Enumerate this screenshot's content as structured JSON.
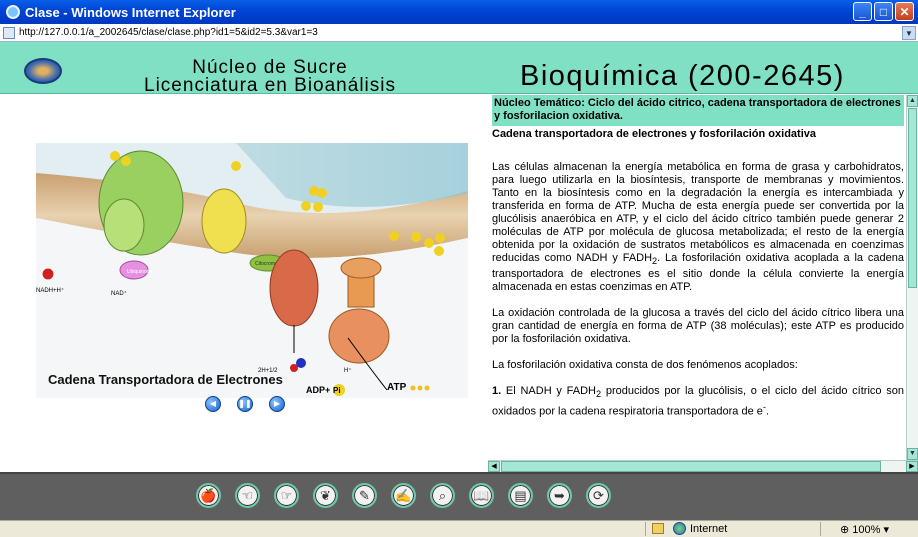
{
  "window": {
    "title": "Clase - Windows Internet Explorer",
    "url": "http://127.0.0.1/a_2002645/clase/clase.php?id1=5&id2=5.3&var1=3"
  },
  "header": {
    "line1": "Núcleo de Sucre",
    "line2": "Licenciatura en Bioanálisis",
    "course": "Bioquímica (200-2645)"
  },
  "figure": {
    "caption": "Cadena Transportadora de Electrones",
    "labels": {
      "nadh": "NADH+H⁺",
      "nad": "NAD⁺",
      "water": "2H+1/2",
      "adp": "ADP+",
      "pi": "Pi",
      "atp": "ATP",
      "hplus": "H⁺",
      "ubiquinona": "Ubiquinona",
      "citocromo": "Citocromo"
    },
    "controls": [
      "rewind",
      "pause",
      "play"
    ]
  },
  "content": {
    "tema": "Núcleo Temático: Ciclo del ácido citrico, cadena transportadora de electrones y fosforilacion oxidativa.",
    "subtitle": "Cadena transportadora de electrones y fosforilación oxidativa",
    "p1": "Las células almacenan la energía metabólica en forma de grasa y carbohidratos, para luego utilizarla en la biosíntesis, transporte de membranas y movimientos. Tanto en la biosíntesis como en la degradación la energía es intercambiada y transferida en forma de ATP. Mucha de esta energía puede ser convertida por la glucólisis anaeróbica en ATP, y el ciclo del ácido cítrico también puede generar 2 moléculas de ATP por molécula de glucosa metabolizada; el resto de la energía obtenida por la oxidación de sustratos metabólicos es almacenada en coenzimas reducidas como NADH y FADH",
    "p1_sub": "2",
    "p1_tail": ". La fosforilación oxidativa acoplada a la cadena transportadora de electrones es el sitio donde la célula convierte la energía almacenada en estas coenzimas en ATP.",
    "p2": "La oxidación controlada de la glucosa a través del ciclo del ácido cítrico libera una gran cantidad de energía en forma de ATP (38 moléculas); este ATP es producido por la fosforilación oxidativa.",
    "p3": "La fosforilación oxidativa consta de dos fenómenos acoplados:",
    "p4_num": "1.",
    "p4a": " El NADH y FADH",
    "p4_sub": "2",
    "p4b": " producidos por la glucólisis, o el ciclo del ácido cítrico son oxidados por la cadena respiratoria transportadora de e",
    "p4_sup": "-",
    "p4_end": "."
  },
  "toolbar": {
    "icons": [
      "apple-icon",
      "hand-left-icon",
      "hand-right-icon",
      "leaf-icon",
      "pencil-icon",
      "pencil-note-icon",
      "search-icon",
      "book-icon",
      "document-icon",
      "export-icon",
      "refresh-icon"
    ],
    "glyphs": [
      "🍎",
      "☜",
      "☞",
      "❦",
      "✎",
      "✍",
      "⌕",
      "📖",
      "▤",
      "➥",
      "⟳"
    ]
  },
  "status": {
    "zone": "Internet",
    "zoom": "100%"
  }
}
